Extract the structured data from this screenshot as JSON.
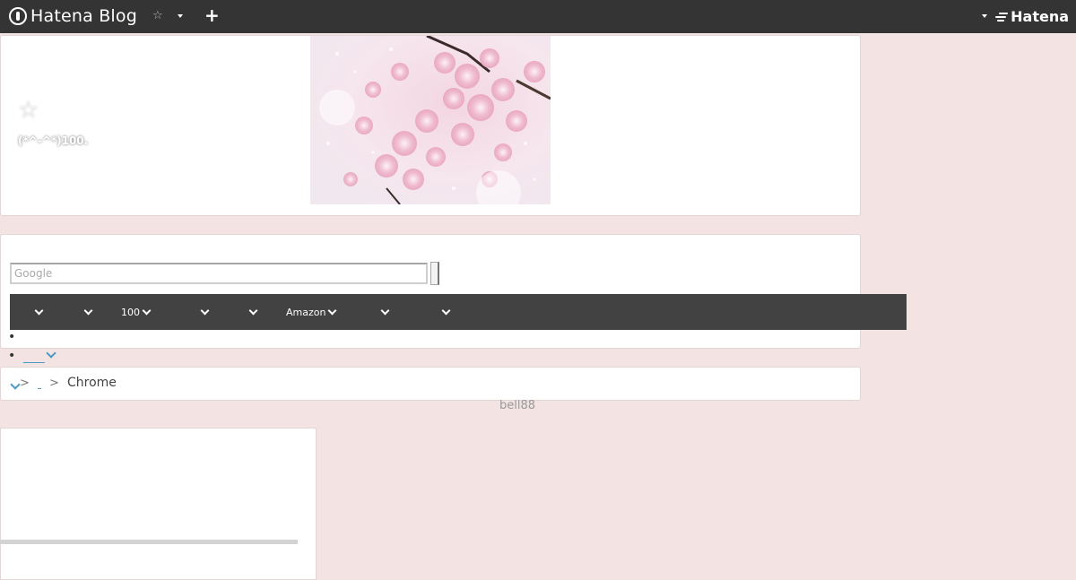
{
  "topbar": {
    "logo_text": "Hatena Blog",
    "star_glyph": "☆",
    "plus_glyph": "+",
    "brand_text": "Hatena"
  },
  "header": {
    "star_glyph": "☆",
    "title": "(*^-^*)100.",
    "image_desc": "cherry-blossom-photo"
  },
  "search": {
    "placeholder": "Google"
  },
  "menu": {
    "items": [
      "",
      "",
      "100",
      "",
      "",
      "Amazon",
      "",
      ""
    ]
  },
  "breadcrumb": {
    "separator": ">",
    "current": "Chrome"
  },
  "author": {
    "name": "bell88"
  },
  "colors": {
    "page_bg": "#f3e3e3",
    "topbar_bg": "#343434",
    "menubar_bg": "#424242",
    "link_blue": "#4a9bc4"
  }
}
